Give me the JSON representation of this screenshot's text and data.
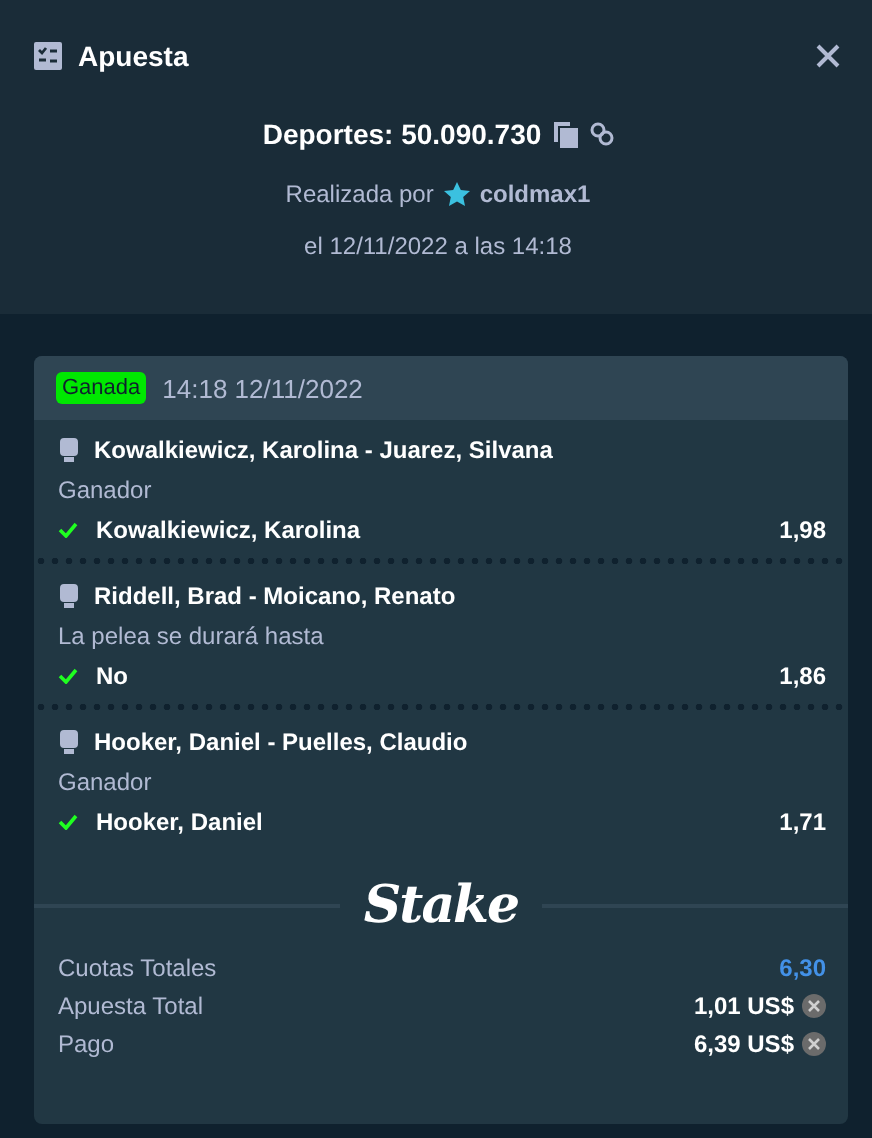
{
  "window": {
    "title": "Apuesta"
  },
  "bet": {
    "label": "Deportes: 50.090.730",
    "placed_by": "Realizada por",
    "user": "coldmax1",
    "date": "el 12/11/2022 a las 14:18"
  },
  "slip": {
    "status": {
      "label": "Ganada",
      "kind": "won"
    },
    "time": "14:18 12/11/2022",
    "legs": [
      {
        "event": "Kowalkiewicz, Karolina - Juarez, Silvana",
        "market": "Ganador",
        "selection": "Kowalkiewicz, Karolina",
        "odds": "1,98",
        "won": true
      },
      {
        "event": "Riddell, Brad - Moicano, Renato",
        "market": "La pelea se durará hasta",
        "selection": "No",
        "odds": "1,86",
        "won": true
      },
      {
        "event": "Hooker, Daniel - Puelles, Claudio",
        "market": "Ganador",
        "selection": "Hooker, Daniel",
        "odds": "1,71",
        "won": true
      }
    ],
    "logo": "Stake",
    "totals": [
      {
        "label": "Cuotas Totales",
        "value": "6,30",
        "kind": "odds"
      },
      {
        "label": "Apuesta Total",
        "value": "1,01 US$",
        "kind": "currency"
      },
      {
        "label": "Pago",
        "value": "6,39 US$",
        "kind": "currency"
      }
    ]
  }
}
